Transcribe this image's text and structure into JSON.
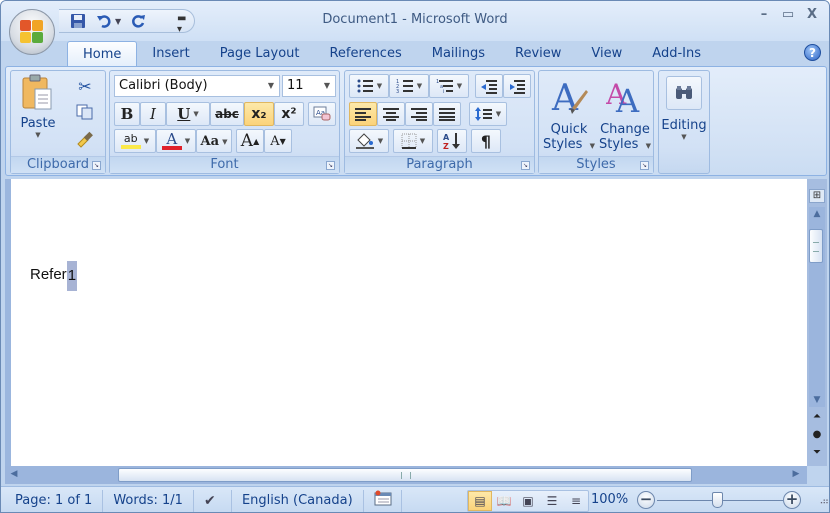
{
  "window": {
    "title_doc": "Document1",
    "title_sep": " - ",
    "title_app": "Microsoft Word",
    "controls": {
      "minimize": "–",
      "maximize": "▭",
      "close": "X"
    }
  },
  "qat": {
    "save_icon": "save-icon",
    "undo_icon": "undo-icon",
    "redo_icon": "redo-icon",
    "customize_icon": "customize-qat-icon"
  },
  "tabs": [
    {
      "label": "Home",
      "active": true
    },
    {
      "label": "Insert"
    },
    {
      "label": "Page Layout"
    },
    {
      "label": "References"
    },
    {
      "label": "Mailings"
    },
    {
      "label": "Review"
    },
    {
      "label": "View"
    },
    {
      "label": "Add-Ins"
    }
  ],
  "ribbon": {
    "clipboard": {
      "label": "Clipboard",
      "paste": "Paste"
    },
    "font": {
      "label": "Font",
      "font_name": "Calibri (Body)",
      "font_size": "11",
      "bold": "B",
      "italic": "I",
      "underline": "U",
      "strikethrough": "abc",
      "subscript": "x₂",
      "superscript": "x²",
      "change_case": "Aa",
      "grow": "A",
      "shrink": "A",
      "highlight": "ab",
      "font_color": "A"
    },
    "paragraph": {
      "label": "Paragraph",
      "pilcrow": "¶"
    },
    "styles": {
      "label": "Styles",
      "quick_line1": "Quick",
      "quick_line2": "Styles",
      "change_line1": "Change",
      "change_line2": "Styles"
    },
    "editing": {
      "label": "Editing"
    }
  },
  "document": {
    "text_before": "Refer",
    "text_selected": "1"
  },
  "statusbar": {
    "page": "Page: 1 of 1",
    "words": "Words: 1/1",
    "language": "English (Canada)",
    "zoom": "100%",
    "zoom_minus": "−",
    "zoom_plus": "+"
  },
  "colors": {
    "accent": "#15428b",
    "highlight_yellow": "#fbe94a",
    "font_color_red": "#e0202a",
    "active_button": "#fbd37a"
  }
}
